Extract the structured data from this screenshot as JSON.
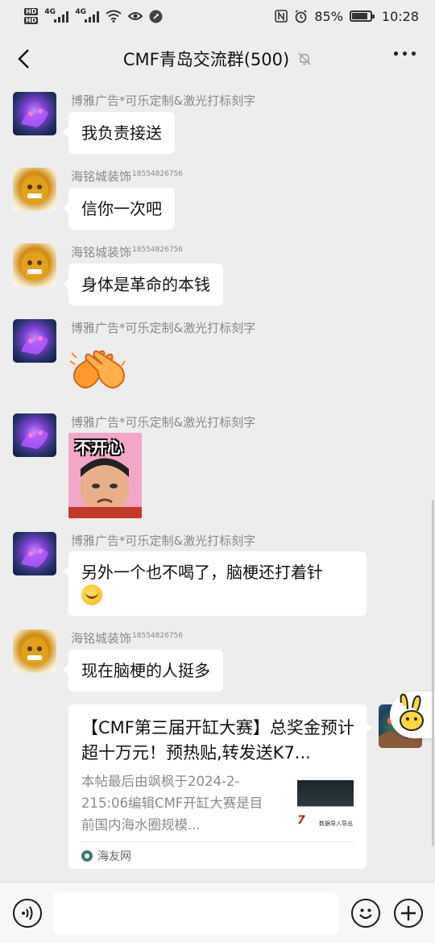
{
  "status_bar": {
    "network_1": "4G",
    "network_2": "4G",
    "battery_percent": "85%",
    "battery_level": 0.85,
    "time": "10:28"
  },
  "header": {
    "title": "CMF青岛交流群(500)"
  },
  "messages": [
    {
      "sender": "博雅广告*可乐定制&激光打标刻字",
      "sender_sup": "",
      "text": "我负责接送"
    },
    {
      "sender": "海铭城装饰",
      "sender_sup": "18554826756",
      "text": "信你一次吧"
    },
    {
      "sender": "海铭城装饰",
      "sender_sup": "18554826756",
      "text": "身体是革命的本钱"
    },
    {
      "sender": "博雅广告*可乐定制&激光打标刻字",
      "sender_sup": "",
      "sticker": "clapping-hands"
    },
    {
      "sender": "博雅广告*可乐定制&激光打标刻字",
      "sender_sup": "",
      "sticker": "不开心",
      "sticker_caption": "不开心"
    },
    {
      "sender": "博雅广告*可乐定制&激光打标刻字",
      "sender_sup": "",
      "text_line1": "另外一个也不喝了，脑梗还打着针"
    },
    {
      "sender": "海铭城装饰",
      "sender_sup": "18554826756",
      "text": "现在脑梗的人挺多"
    }
  ],
  "shared_card": {
    "title": "【CMF第三届开缸大赛】总奖金预计超十万元！预热贴,转发送K7...",
    "description": "本帖最后由飒枫于2024-2-215:06编辑CMF开缸大赛是目前国内海水圈规模...",
    "thumb_text": "7",
    "thumb_caption": "数据导入导出",
    "source": "海友网"
  },
  "colors": {
    "background": "#ededed",
    "bubble": "#ffffff",
    "sender_text": "#8a8a8a"
  }
}
